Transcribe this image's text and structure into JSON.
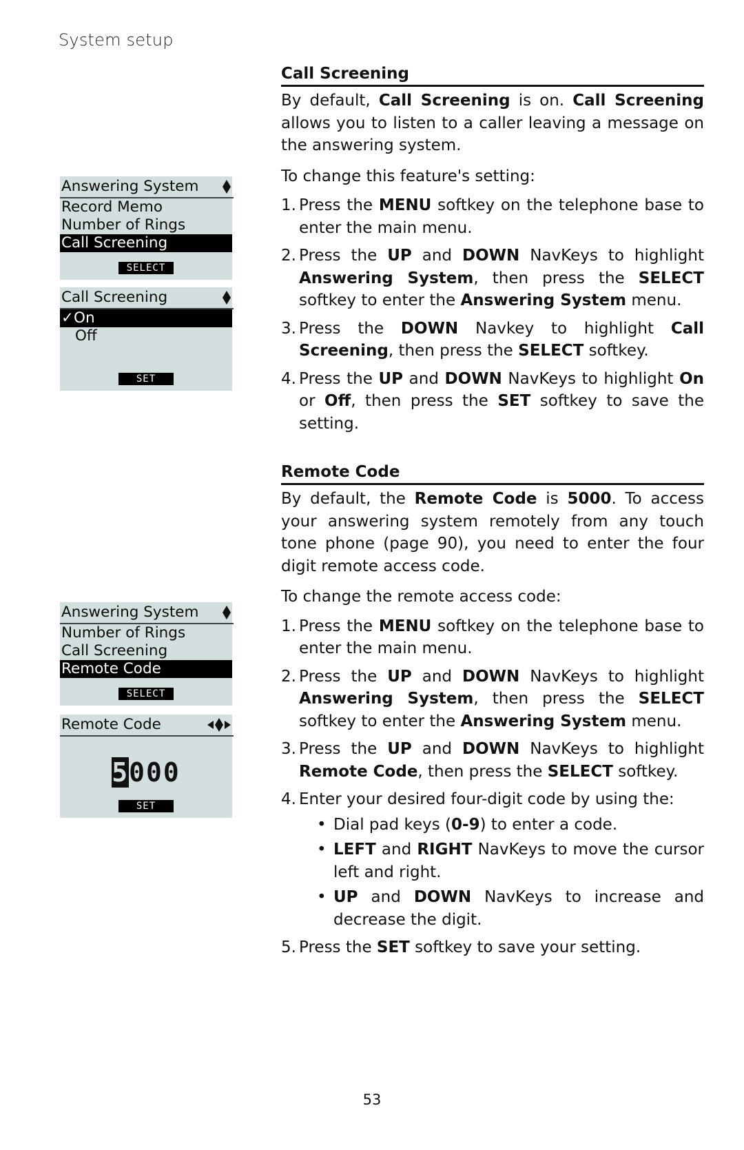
{
  "header": {
    "section": "System setup"
  },
  "page_number": "53",
  "screens": {
    "screen1": {
      "title": "Answering System",
      "nav_icon": "up-down-arrows-icon",
      "items": [
        "Record Memo",
        "Number of Rings",
        "Call Screening"
      ],
      "selected_index": 2,
      "softkey": "SELECT"
    },
    "screen2": {
      "title": "Call Screening",
      "nav_icon": "up-down-arrows-icon",
      "options": [
        {
          "label": "✓On",
          "selected": true
        },
        {
          "label": "Off",
          "selected": false
        }
      ],
      "softkey": "SET"
    },
    "screen3": {
      "title": "Answering System",
      "nav_icon": "up-down-arrows-icon",
      "items": [
        "Number of Rings",
        "Call Screening",
        "Remote Code"
      ],
      "selected_index": 2,
      "softkey": "SELECT"
    },
    "screen4": {
      "title": "Remote Code",
      "nav_icon": "four-way-arrows-icon",
      "code_cursor_digit": "5",
      "code_rest": "000",
      "softkey": "SET"
    }
  },
  "call_screening": {
    "heading": "Call Screening",
    "intro": [
      {
        "t": "By default, "
      },
      {
        "b": "Call Screening"
      },
      {
        "t": " is on. "
      },
      {
        "b": "Call Screening"
      },
      {
        "t": " allows you to listen to a caller leaving a message on the answering system."
      }
    ],
    "lead": "To change this feature's setting:",
    "steps": [
      {
        "num": "1.",
        "parts": [
          {
            "t": "Press the "
          },
          {
            "b": "MENU"
          },
          {
            "t": " softkey on the telephone base to enter the main menu."
          }
        ]
      },
      {
        "num": "2.",
        "parts": [
          {
            "t": "Press the "
          },
          {
            "b": "UP"
          },
          {
            "t": " and "
          },
          {
            "b": "DOWN"
          },
          {
            "t": " NavKeys to highlight "
          },
          {
            "b": "Answering System"
          },
          {
            "t": ", then press the "
          },
          {
            "b": "SELECT"
          },
          {
            "t": " softkey to enter the "
          },
          {
            "b": "Answering System"
          },
          {
            "t": " menu."
          }
        ]
      },
      {
        "num": "3.",
        "parts": [
          {
            "t": "Press the "
          },
          {
            "b": "DOWN"
          },
          {
            "t": " Navkey to highlight "
          },
          {
            "b": "Call Screening"
          },
          {
            "t": ", then press the "
          },
          {
            "b": "SELECT"
          },
          {
            "t": " softkey."
          }
        ]
      },
      {
        "num": "4.",
        "parts": [
          {
            "t": "Press the "
          },
          {
            "b": "UP"
          },
          {
            "t": " and "
          },
          {
            "b": "DOWN"
          },
          {
            "t": " NavKeys to highlight "
          },
          {
            "b": "On"
          },
          {
            "t": " or "
          },
          {
            "b": "Off"
          },
          {
            "t": ", then press the "
          },
          {
            "b": "SET"
          },
          {
            "t": " softkey to save the setting."
          }
        ]
      }
    ]
  },
  "remote_code": {
    "heading": "Remote Code",
    "intro": [
      {
        "t": "By default, the "
      },
      {
        "b": "Remote Code"
      },
      {
        "t": " is "
      },
      {
        "b": "5000"
      },
      {
        "t": ". To access your answering system remotely from any touch tone phone (page 90), you need to enter the four digit remote access code."
      }
    ],
    "lead": "To change the remote access code:",
    "steps": [
      {
        "num": "1.",
        "parts": [
          {
            "t": "Press the "
          },
          {
            "b": "MENU"
          },
          {
            "t": " softkey on the telephone base to enter the main menu."
          }
        ]
      },
      {
        "num": "2.",
        "parts": [
          {
            "t": "Press the "
          },
          {
            "b": "UP"
          },
          {
            "t": " and "
          },
          {
            "b": "DOWN"
          },
          {
            "t": " NavKeys to highlight "
          },
          {
            "b": "Answering System"
          },
          {
            "t": ", then press the "
          },
          {
            "b": "SELECT"
          },
          {
            "t": " softkey to enter the "
          },
          {
            "b": "Answering System"
          },
          {
            "t": " menu."
          }
        ]
      },
      {
        "num": "3.",
        "parts": [
          {
            "t": "Press the "
          },
          {
            "b": "UP"
          },
          {
            "t": " and "
          },
          {
            "b": "DOWN"
          },
          {
            "t": " NavKeys to highlight "
          },
          {
            "b": "Remote Code"
          },
          {
            "t": ", then press the "
          },
          {
            "b": "SELECT"
          },
          {
            "t": " softkey."
          }
        ]
      },
      {
        "num": "4.",
        "parts": [
          {
            "t": "Enter your desired four-digit code by using the:"
          }
        ],
        "bullets": [
          [
            {
              "t": "Dial pad keys ("
            },
            {
              "b": "0-9"
            },
            {
              "t": ") to enter a code."
            }
          ],
          [
            {
              "b": "LEFT"
            },
            {
              "t": " and "
            },
            {
              "b": "RIGHT"
            },
            {
              "t": " NavKeys to move the cursor left and right."
            }
          ],
          [
            {
              "b": "UP"
            },
            {
              "t": " and "
            },
            {
              "b": "DOWN"
            },
            {
              "t": " NavKeys to increase and decrease the digit."
            }
          ]
        ]
      },
      {
        "num": "5.",
        "parts": [
          {
            "t": "Press the "
          },
          {
            "b": "SET"
          },
          {
            "t": " softkey to save your setting."
          }
        ]
      }
    ]
  }
}
